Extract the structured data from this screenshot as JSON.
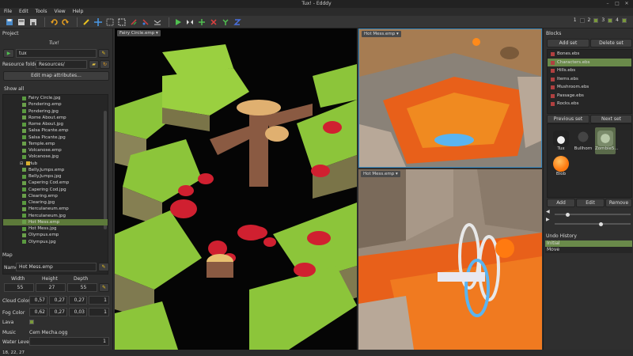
{
  "window": {
    "title": "Tux! - Edddy"
  },
  "menu": [
    "File",
    "Edit",
    "Tools",
    "View",
    "Help"
  ],
  "layers": {
    "labels": [
      "1",
      "2",
      "3",
      "4"
    ],
    "checked": [
      false,
      true,
      true,
      true
    ]
  },
  "project": {
    "header": "Project",
    "name": "Tux!",
    "entity": "tux",
    "resource_label": "Resource folder:",
    "resource_value": "Resources/",
    "edit_attrs": "Edit map attributes...",
    "show_all": "Show all"
  },
  "tree": [
    {
      "name": "Fairy Circle.jpg",
      "type": "jpg"
    },
    {
      "name": "Pondering.emp",
      "type": "emp"
    },
    {
      "name": "Pondering.jpg",
      "type": "jpg"
    },
    {
      "name": "Rome About.emp",
      "type": "emp"
    },
    {
      "name": "Rome About.jpg",
      "type": "jpg"
    },
    {
      "name": "Salsa Picante.emp",
      "type": "emp"
    },
    {
      "name": "Salsa Picante.jpg",
      "type": "jpg"
    },
    {
      "name": "Temple.emp",
      "type": "emp"
    },
    {
      "name": "Volcanose.emp",
      "type": "emp"
    },
    {
      "name": "Volcanose.jpg",
      "type": "jpg"
    },
    {
      "name": "Hub",
      "type": "folder"
    },
    {
      "name": "Belly.Jumps.emp",
      "type": "emp"
    },
    {
      "name": "Belly.Jumps.jpg",
      "type": "jpg"
    },
    {
      "name": "Capering Cod.emp",
      "type": "emp"
    },
    {
      "name": "Capering Cod.jpg",
      "type": "jpg"
    },
    {
      "name": "Clearing.emp",
      "type": "emp"
    },
    {
      "name": "Clearing.jpg",
      "type": "jpg"
    },
    {
      "name": "Herculaneum.emp",
      "type": "emp"
    },
    {
      "name": "Herculaneum.jpg",
      "type": "jpg"
    },
    {
      "name": "Hot Mess.emp",
      "type": "emp",
      "selected": true
    },
    {
      "name": "Hot Mess.jpg",
      "type": "jpg"
    },
    {
      "name": "Olympus.emp",
      "type": "emp"
    },
    {
      "name": "Olympus.jpg",
      "type": "jpg"
    }
  ],
  "map": {
    "header": "Map",
    "name_label": "Name:",
    "name_value": "Hot Mess.emp",
    "width_label": "Width",
    "width": "55",
    "height_label": "Height",
    "height": "27",
    "depth_label": "Depth",
    "depth": "55",
    "cloud_label": "Cloud Color",
    "cloud": [
      "0,57",
      "0,27",
      "0,27",
      "1"
    ],
    "fog_label": "Fog Color",
    "fog": [
      "0,62",
      "0,27",
      "0,03",
      "1"
    ],
    "lava_label": "Lava",
    "music_label": "Music",
    "music": "Cem Mecha.ogg",
    "water_label": "Water Level",
    "water": "1"
  },
  "views": [
    {
      "tab": "Fairy Circle.emp"
    },
    {
      "tab": "Hot Mess.emp"
    },
    {
      "tab": "Hot Mess.emp"
    }
  ],
  "blocks": {
    "header": "Blocks",
    "add_set": "Add set",
    "delete_set": "Delete set",
    "list": [
      "Bones.ebs",
      "Characters.ebs",
      "Hills.ebs",
      "Items.ebs",
      "Mushroom.ebs",
      "Passage.ebs",
      "Rocks.ebs"
    ],
    "selected": "Characters.ebs",
    "prev": "Previous set",
    "next": "Next set",
    "palette": [
      {
        "name": "Tux",
        "color": "#e0e0e0"
      },
      {
        "name": "Bullhorn",
        "color": "#303030"
      },
      {
        "name": "Zombie5...",
        "color": "#8a9a6a"
      },
      {
        "name": "Blob",
        "color": "#ff8a1a"
      }
    ],
    "add": "Add",
    "edit": "Edit",
    "remove": "Remove"
  },
  "sliders": [
    0.15,
    0.62
  ],
  "undo": {
    "header": "Undo History",
    "items": [
      "Initial",
      "Move"
    ],
    "selected": "Initial"
  },
  "status": "18, 22, 27"
}
